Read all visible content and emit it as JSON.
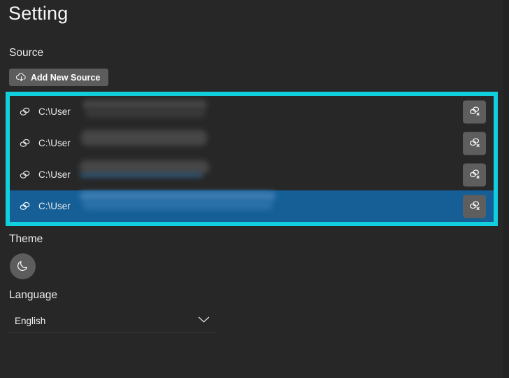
{
  "page": {
    "title": "Setting",
    "background_color": "#272727",
    "accent_highlight_color": "#12cfdd",
    "selected_row_color": "#155e96"
  },
  "source_section": {
    "label": "Source",
    "add_button": {
      "label": "Add New Source",
      "icon": "cloud-download-icon"
    },
    "list_highlight": {
      "color": "#12cfdd",
      "width": 6
    },
    "row_icon": "link-icon",
    "row_action_icon": "unlink-icon",
    "rows": [
      {
        "path": "C:\\User",
        "redacted": true,
        "selected": false
      },
      {
        "path": "C:\\User",
        "redacted": true,
        "selected": false
      },
      {
        "path": "C:\\User",
        "redacted": true,
        "selected": false
      },
      {
        "path": "C:\\User",
        "redacted": true,
        "selected": true
      }
    ]
  },
  "theme_section": {
    "label": "Theme",
    "toggle_icon": "moon-icon"
  },
  "language_section": {
    "label": "Language",
    "selected_value": "English",
    "chevron_icon": "chevron-down-icon"
  }
}
